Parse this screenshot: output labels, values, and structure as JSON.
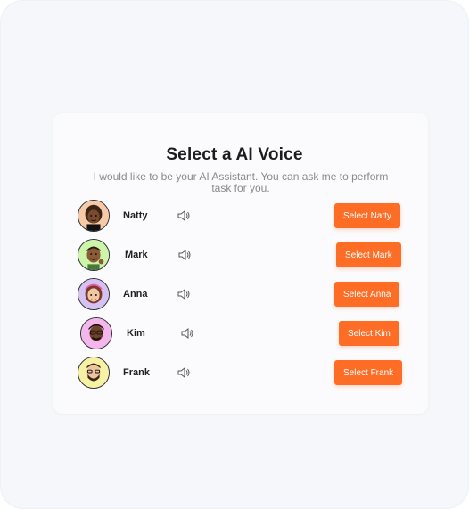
{
  "header": {
    "title": "Select a AI Voice",
    "subtitle": "I would like to be your AI Assistant. You can ask me to perform task for you."
  },
  "voices": [
    {
      "name": "Natty",
      "button": "Select Natty",
      "avatar_bg": "#f8c9a6",
      "skin": "#7a4a2c",
      "hair": "#3b2417"
    },
    {
      "name": "Mark",
      "button": "Select Mark",
      "avatar_bg": "#cdf5a9",
      "skin": "#8b5a36",
      "hair": "#2b1b10"
    },
    {
      "name": "Anna",
      "button": "Select Anna",
      "avatar_bg": "#d6c1f4",
      "skin": "#f0c7a3",
      "hair": "#e85ea6"
    },
    {
      "name": "Kim",
      "button": "Select Kim",
      "avatar_bg": "#f5b6ee",
      "skin": "#6e4229",
      "hair": "#1c120c"
    },
    {
      "name": "Frank",
      "button": "Select Frank",
      "avatar_bg": "#f7f1a4",
      "skin": "#f1c4a0",
      "hair": "#3a2617"
    }
  ],
  "icons": {
    "speaker": "speaker-icon"
  },
  "colors": {
    "accent": "#fe6d26",
    "background": "#f6f7fb",
    "card": "#fbfbfd"
  }
}
